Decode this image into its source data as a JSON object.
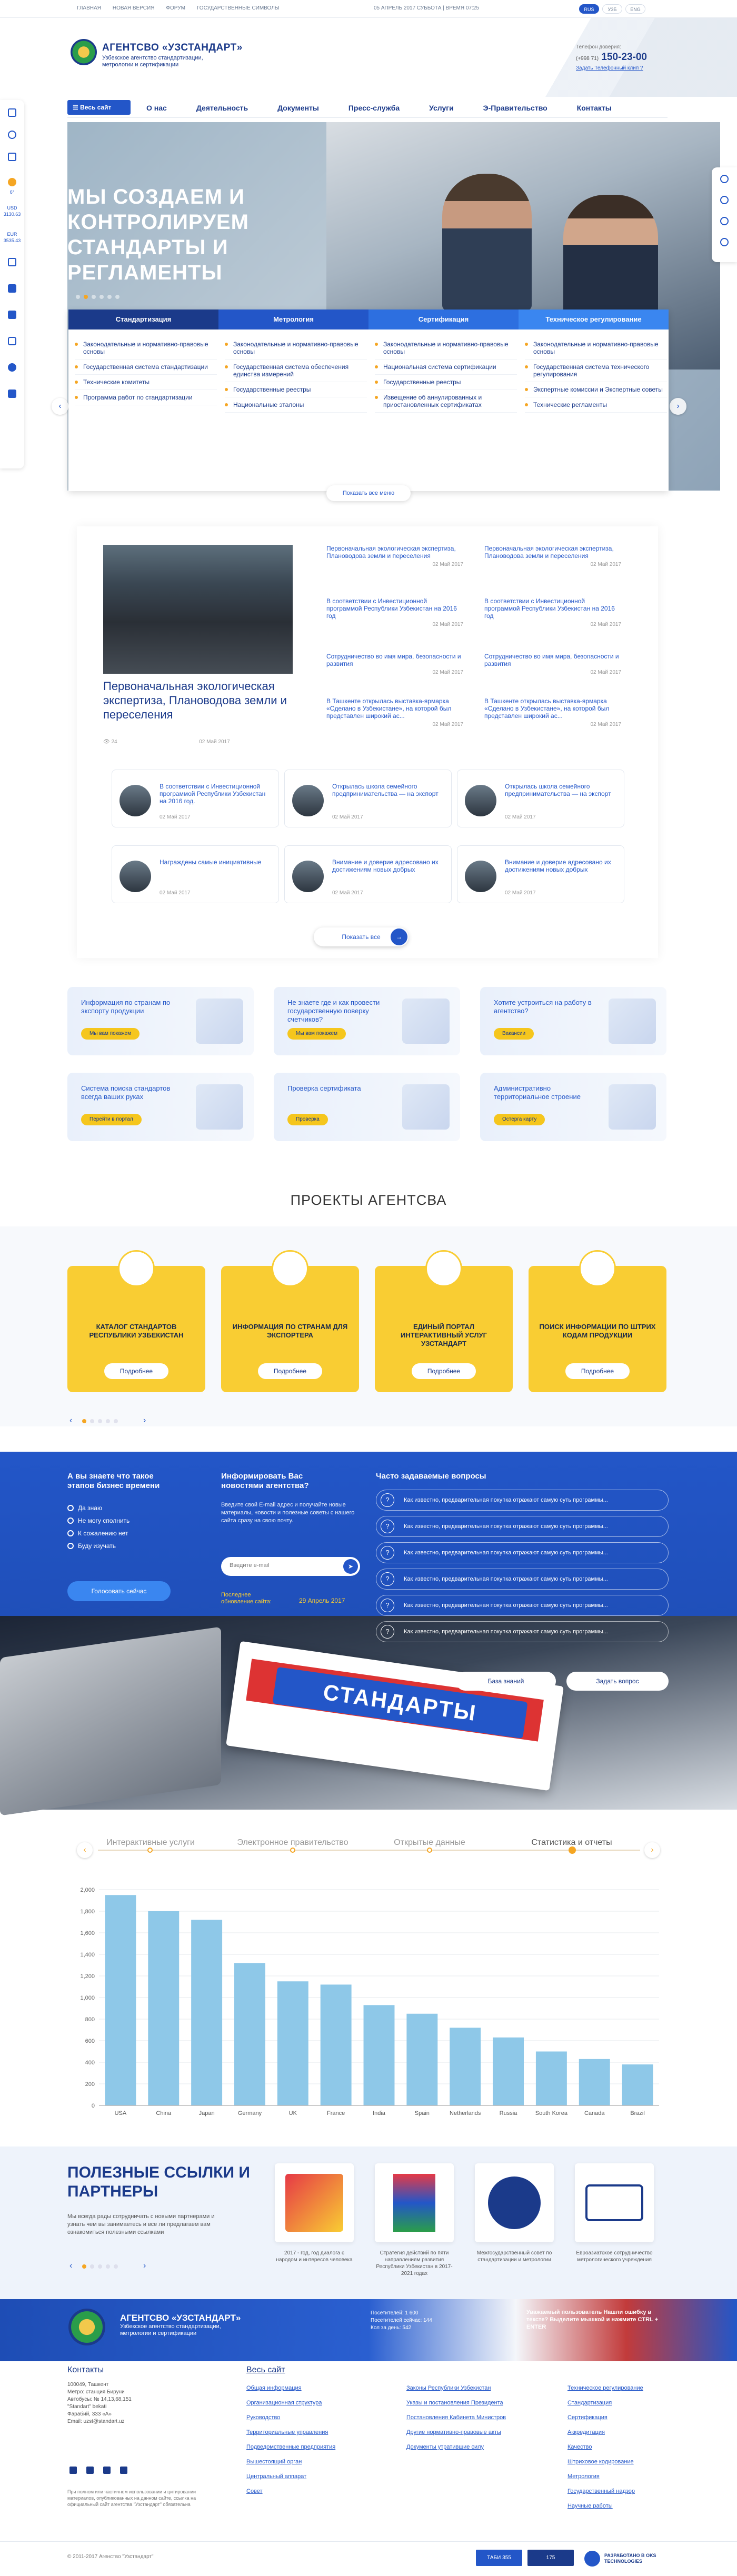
{
  "topbar": {
    "links": [
      "ГЛАВНАЯ",
      "НОВАЯ ВЕРСИЯ",
      "ФОРУМ",
      "ГОСУДАРСТВЕННЫЕ СИМВОЛЫ"
    ],
    "date": "05 АПРЕЛЬ 2017 СУББОТА | ВРЕМЯ 07:25",
    "langs": [
      "RUS",
      "УЗБ",
      "ENG"
    ],
    "active_lang": "RUS"
  },
  "header": {
    "title": "АГЕНТСВО «УЗСТАНДАРТ»",
    "subtitle": "Узбекское агентство стандартизации, метрологии и сертификации",
    "phone_label": "Телефон доверия:",
    "phone_prefix": "(+998 71)",
    "phone": "150-23-00",
    "phone_link": "Задать Телефонный клип ?"
  },
  "nav": {
    "all_site": "Весь сайт",
    "items": [
      "О нас",
      "Деятельность",
      "Документы",
      "Пресс-служба",
      "Услуги",
      "Э-Правительство",
      "Контакты"
    ]
  },
  "leftbar": {
    "weather_temp": "6°",
    "usd_label": "USD",
    "usd_rate": "3130.63",
    "eur_label": "EUR",
    "eur_rate": "3535.43"
  },
  "hero": {
    "title": "МЫ СОЗДАЕМ И КОНТРОЛИРУЕМ СТАНДАРТЫ И РЕГЛАМЕНТЫ",
    "slides_total": 6,
    "slide_active": 2,
    "prev_arrow": "‹",
    "next_arrow": "›"
  },
  "tabs": [
    {
      "title": "Стандартизация",
      "color": "#1b3a8a",
      "items": [
        "Законодательные и нормативно-правовые основы",
        "Государственная система стандартизации",
        "Технические комитеты",
        "Программа работ по стандартизации"
      ]
    },
    {
      "title": "Метрология",
      "color": "#2356c8",
      "items": [
        "Законодательные и нормативно-правовые основы",
        "Государственная система обеспечения единства измерений",
        "Государственные реестры",
        "Национальные эталоны"
      ]
    },
    {
      "title": "Сертификация",
      "color": "#2d6fe0",
      "items": [
        "Законодательные и нормативно-правовые основы",
        "Национальная система сертификации",
        "Государственные реестры",
        "Извещение об аннулированных и приостановленных сертификатах"
      ]
    },
    {
      "title": "Техническое регулирование",
      "color": "#3a86f0",
      "items": [
        "Законодательные и нормативно-правовые основы",
        "Государственная система технического регулирования",
        "Экспертные комиссии и Экспертные советы",
        "Технические регламенты"
      ]
    }
  ],
  "tabs_show_all": "Показать все меню",
  "news": {
    "main_title": "Первоначальная экологическая экспертиза, Плановодова земли и переселения",
    "main_views": "24",
    "main_date": "02 Май 2017",
    "items": [
      {
        "title": "Первоначальная экологическая экспертиза, Плановодова земли и переселения",
        "date": "02 Май 2017"
      },
      {
        "title": "Первоначальная экологическая экспертиза, Плановодова земли и переселения",
        "date": "02 Май 2017"
      },
      {
        "title": "В соответствии с Инвестиционной программой Республики Узбекистан на 2016 год",
        "date": "02 Май 2017"
      },
      {
        "title": "В соответствии с Инвестиционной программой Республики Узбекистан на 2016 год",
        "date": "02 Май 2017"
      },
      {
        "title": "Сотрудничество во имя мира, безопасности и развития",
        "date": "02 Май 2017"
      },
      {
        "title": "Сотрудничество во имя мира, безопасности и развития",
        "date": "02 Май 2017"
      },
      {
        "title": "В Ташкенте открылась выставка-ярмарка «Сделано в Узбекистане», на которой был представлен широкий ас...",
        "date": "02 Май 2017"
      },
      {
        "title": "В Ташкенте открылась выставка-ярмарка «Сделано в Узбекистане», на которой был представлен широкий ас...",
        "date": "02 Май 2017"
      }
    ],
    "cards": [
      {
        "title": "В соответствии с Инвестиционной программой Республики Узбекистан на 2016 год.",
        "date": "02 Май 2017"
      },
      {
        "title": "Открылась школа семейного предпринимательства — на экспорт",
        "date": "02 Май 2017"
      },
      {
        "title": "Открылась школа семейного предпринимательства — на экспорт",
        "date": "02 Май 2017"
      },
      {
        "title": "Награждены самые инициативные",
        "date": "02 Май 2017"
      },
      {
        "title": "Внимание и доверие адресовано их достижениям новых добрых",
        "date": "02 Май 2017"
      },
      {
        "title": "Внимание и доверие адресовано их достижениям новых добрых",
        "date": "02 Май 2017"
      }
    ],
    "show_all": "Показать все",
    "show_all_arrow": "→"
  },
  "services": [
    {
      "title": "Информация по странам по экспорту продукции",
      "button": "Мы вам покажем"
    },
    {
      "title": "Не знаете где и как провести государственную поверку счетчиков?",
      "button": "Мы вам покажем"
    },
    {
      "title": "Хотите устроиться на работу в агентство?",
      "button": "Вакансии"
    },
    {
      "title": "Система поиска стандартов всегда ваших руках",
      "button": "Перейти в портал"
    },
    {
      "title": "Проверка сертификата",
      "button": "Проверка"
    },
    {
      "title": "Административно территориальное строение",
      "button": "Остерга карту"
    }
  ],
  "projects": {
    "heading": "ПРОЕКТЫ АГЕНТСВА",
    "items": [
      {
        "title": "КАТАЛОГ СТАНДАРТОВ РЕСПУБЛИКИ УЗБЕКИСТАН",
        "button": "Подробнее"
      },
      {
        "title": "ИНФОРМАЦИЯ ПО СТРАНАМ ДЛЯ ЭКСПОРТЕРА",
        "button": "Подробнее"
      },
      {
        "title": "ЕДИНЫЙ ПОРТАЛ ИНТЕРАКТИВНЫЙ УСЛУГ УЗСТАНДАРТ",
        "button": "Подробнее"
      },
      {
        "title": "ПОИСК ИНФОРМАЦИИ ПО ШТРИХ КОДАМ ПРОДУКЦИИ",
        "button": "Подробнее"
      }
    ],
    "prev": "‹",
    "next": "›"
  },
  "poll": {
    "question": "А вы знаете что такое этапов бизнес времени",
    "options": [
      "Да знаю",
      "Не могу сполнить",
      "К сожалению нет",
      "Буду изучать"
    ],
    "vote": "Голосовать сейчас"
  },
  "subscribe": {
    "title": "Информировать Вас новостями агентства?",
    "text": "Введите свой E-mail адрес и получайте новые материалы, новости и полезные советы с нашего сайта сразу на свою почту.",
    "placeholder": "Введите e-mail",
    "updated_label": "Последнее обновление сайта:",
    "updated_date": "29 Апрель 2017"
  },
  "faq": {
    "title": "Часто задаваемые вопросы",
    "items": [
      "Как известно, предварительная покупка отражают самую суть программы...",
      "Как известно, предварительная покупка отражают самую суть программы...",
      "Как известно, предварительная покупка отражают самую суть программы...",
      "Как известно, предварительная покупка отражают самую суть программы...",
      "Как известно, предварительная покупка отражают самую суть программы...",
      "Как известно, предварительная покупка отражают самую суть программы..."
    ],
    "kb_button": "База знаний",
    "ask_button": "Задать вопрос"
  },
  "standards_label": "СТАНДАРТЫ",
  "timeline": [
    "Интерактивные услуги",
    "Электронное правительство",
    "Открытые данные",
    "Статистика и отчеты"
  ],
  "timeline_active": 3,
  "chart_data": {
    "type": "bar",
    "categories": [
      "USA",
      "China",
      "Japan",
      "Germany",
      "UK",
      "France",
      "India",
      "Spain",
      "Netherlands",
      "Russia",
      "South Korea",
      "Canada",
      "Brazil"
    ],
    "values": [
      1950,
      1800,
      1720,
      1320,
      1150,
      1120,
      930,
      850,
      720,
      630,
      500,
      430,
      380
    ],
    "yticks": [
      0,
      200,
      400,
      600,
      800,
      1000,
      1200,
      1400,
      1600,
      1800,
      2000
    ],
    "ylim": [
      0,
      2000
    ],
    "bar_color": "#8ec8e8",
    "grid": true
  },
  "links_section": {
    "title": "ПОЛЕЗНЫЕ ССЫЛКИ И ПАРТНЕРЫ",
    "text": "Мы всегда рады сотрудничать с новыми партнерами и узнать чем вы занимаетесь и все ли предлагаем вам ознакомиться полезными ссылками",
    "partners": [
      {
        "caption": "2017 - год, год диалога с народом и интересов человека"
      },
      {
        "caption": "Стратегия действий по пяти направлениям развития Республики Узбекистан в 2017-2021 годах"
      },
      {
        "caption": "Межгосударственный совет по стандартизации и метрологии"
      },
      {
        "caption": "Евроазиатское сотрудничество метрологического учреждения"
      }
    ],
    "prev": "‹",
    "next": "›"
  },
  "footer_band": {
    "title": "АГЕНТСВО «УЗСТАНДАРТ»",
    "subtitle": "Узбекское агентство стандартизации, метрологии и сертификации",
    "visitors_label": "Посетителей: 1 600",
    "visitors_online": "Посетителей сейчас: 144",
    "visitors_today": "Кол за день: 542",
    "error_text": "Уважаемый пользователь Нашли ошибку в тексте? Выделите мышкой и нажмите CTRL + ENTER"
  },
  "footer": {
    "contacts_title": "Контакты",
    "address": [
      "100049, Ташкент",
      "Метро: станция Бируни",
      "Автобусы: № 14,13,68,151",
      "\"Standart\" bekati",
      "Фарабий, 333 «А»",
      "Email: uzst@standart.uz"
    ],
    "disclaimer": "При полном или частичном использовании и цитировании материалов, опубликованных на данном сайте, ссылка на официальный сайт агентства \"Узстандарт\" обязательна",
    "site_title": "Весь сайт",
    "col1": [
      "Общая информация",
      "Организационная структура",
      "Руководство",
      "Территориальные управления",
      "Подведомственные предприятия",
      "Вышестоящий орган",
      "Центральный аппарат",
      "Совет"
    ],
    "col2": [
      "Законы Республики Узбекистан",
      "Указы и постановления Президента",
      "Постановления Кабинета Министров",
      "Другие нормативно-правовые акты",
      "Документы утратившие силу"
    ],
    "col3": [
      "Техническое регулирование",
      "Стандартизация",
      "Сертификация",
      "Аккредитация",
      "Качество",
      "Штриховое кодирование",
      "Метрология",
      "Государственный надзор",
      "Научные работы"
    ],
    "copyright": "© 2011-2017 Агенство \"Узстандарт\"",
    "counter1": "ТАБИ 355",
    "counter2": "175",
    "developer": "РАЗРАБОТАНО В OKS TECHNOLOGIES"
  },
  "colors": {
    "brand": "#1b3a8a",
    "accent": "#2356c8",
    "yellow": "#f9cd33",
    "orange": "#f5a623"
  }
}
